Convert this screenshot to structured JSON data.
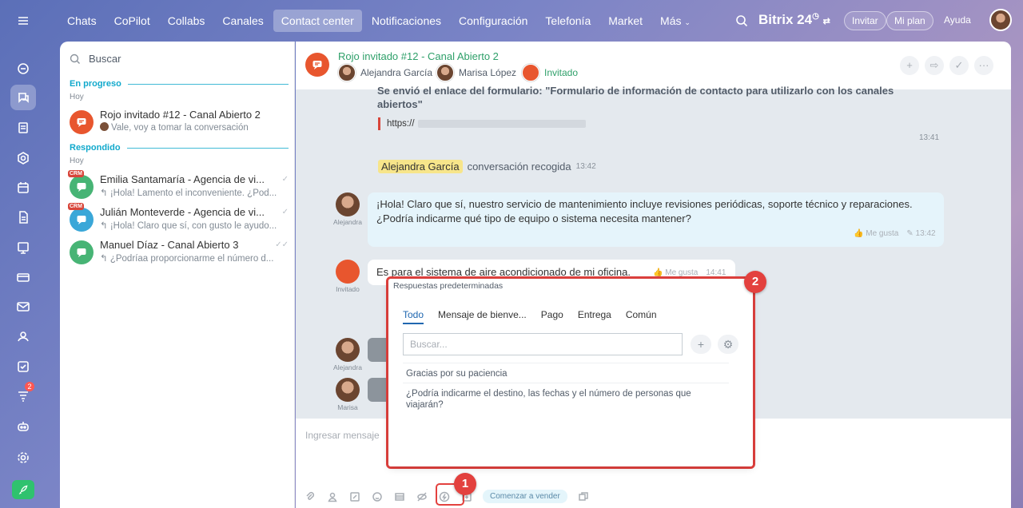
{
  "nav": {
    "items": [
      "Chats",
      "CoPilot",
      "Collabs",
      "Canales",
      "Contact center",
      "Notificaciones",
      "Configuración",
      "Telefonía",
      "Market",
      "Más"
    ],
    "active_index": 4,
    "brand": "Bitrix 24",
    "buttons": [
      "Invitar",
      "Mi plan",
      "Ayuda"
    ]
  },
  "rail": {
    "badge_count": "2"
  },
  "sidebar": {
    "search_placeholder": "Buscar",
    "sections": [
      {
        "title": "En progreso",
        "sub": "Hoy"
      },
      {
        "title": "Respondido",
        "sub": "Hoy"
      }
    ],
    "chats": [
      {
        "title": "Rojo invitado #12 - Canal Abierto 2",
        "preview": "Vale, voy a tomar la conversación",
        "color": "#e8562e",
        "crm": false
      },
      {
        "title": "Emilia Santamaría - Agencia de vi...",
        "preview": "¡Hola! Lamento el inconveniente. ¿Pod...",
        "color": "#47b475",
        "crm": true
      },
      {
        "title": "Julián Monteverde - Agencia de vi...",
        "preview": "¡Hola! Claro que sí, con gusto le ayudo...",
        "color": "#3aa7d8",
        "crm": true
      },
      {
        "title": "Manuel Díaz - Canal Abierto 3",
        "preview": "¿Podríaa proporcionarme el número d...",
        "color": "#47b475",
        "crm": false
      }
    ],
    "crm_label": "CRM"
  },
  "chat": {
    "title": "Rojo invitado #12 - Canal Abierto 2",
    "members": [
      "Alejandra García",
      "Marisa López",
      "Invitado"
    ],
    "system_text": "Se envió el enlace del formulario: \"Formulario de información de contacto para utilizarlo con los canales abiertos\"",
    "link_prefix": "https://",
    "time_system": "13:41",
    "tag_name": "Alejandra García",
    "tag_text": "conversación recogida",
    "tag_time": "13:42",
    "msg1": {
      "author": "Alejandra",
      "text1": "¡Hola! Claro que sí, nuestro servicio de mantenimiento incluye revisiones periódicas, soporte técnico y reparaciones.",
      "text2": "¿Podría indicarme qué tipo de equipo o sistema necesita mantener?",
      "like": "Me gusta",
      "time": "13:42"
    },
    "msg2": {
      "author": "Invitado",
      "text": "Es para el sistema de aire acondicionado de mi oficina.",
      "like": "Me gusta",
      "time": "14:41"
    },
    "msg3_author": "Alejandra",
    "msg4_author": "Marisa",
    "composer_placeholder": "Ingresar mensaje",
    "sell_button": "Comenzar a vender"
  },
  "popup": {
    "title": "Respuestas predeterminadas",
    "tabs": [
      "Todo",
      "Mensaje de bienve...",
      "Pago",
      "Entrega",
      "Común"
    ],
    "search_placeholder": "Buscar...",
    "answers": [
      "Gracias por su paciencia",
      "¿Podría indicarme el destino, las fechas y el número de personas que viajarán?"
    ]
  },
  "callouts": [
    "1",
    "2"
  ]
}
